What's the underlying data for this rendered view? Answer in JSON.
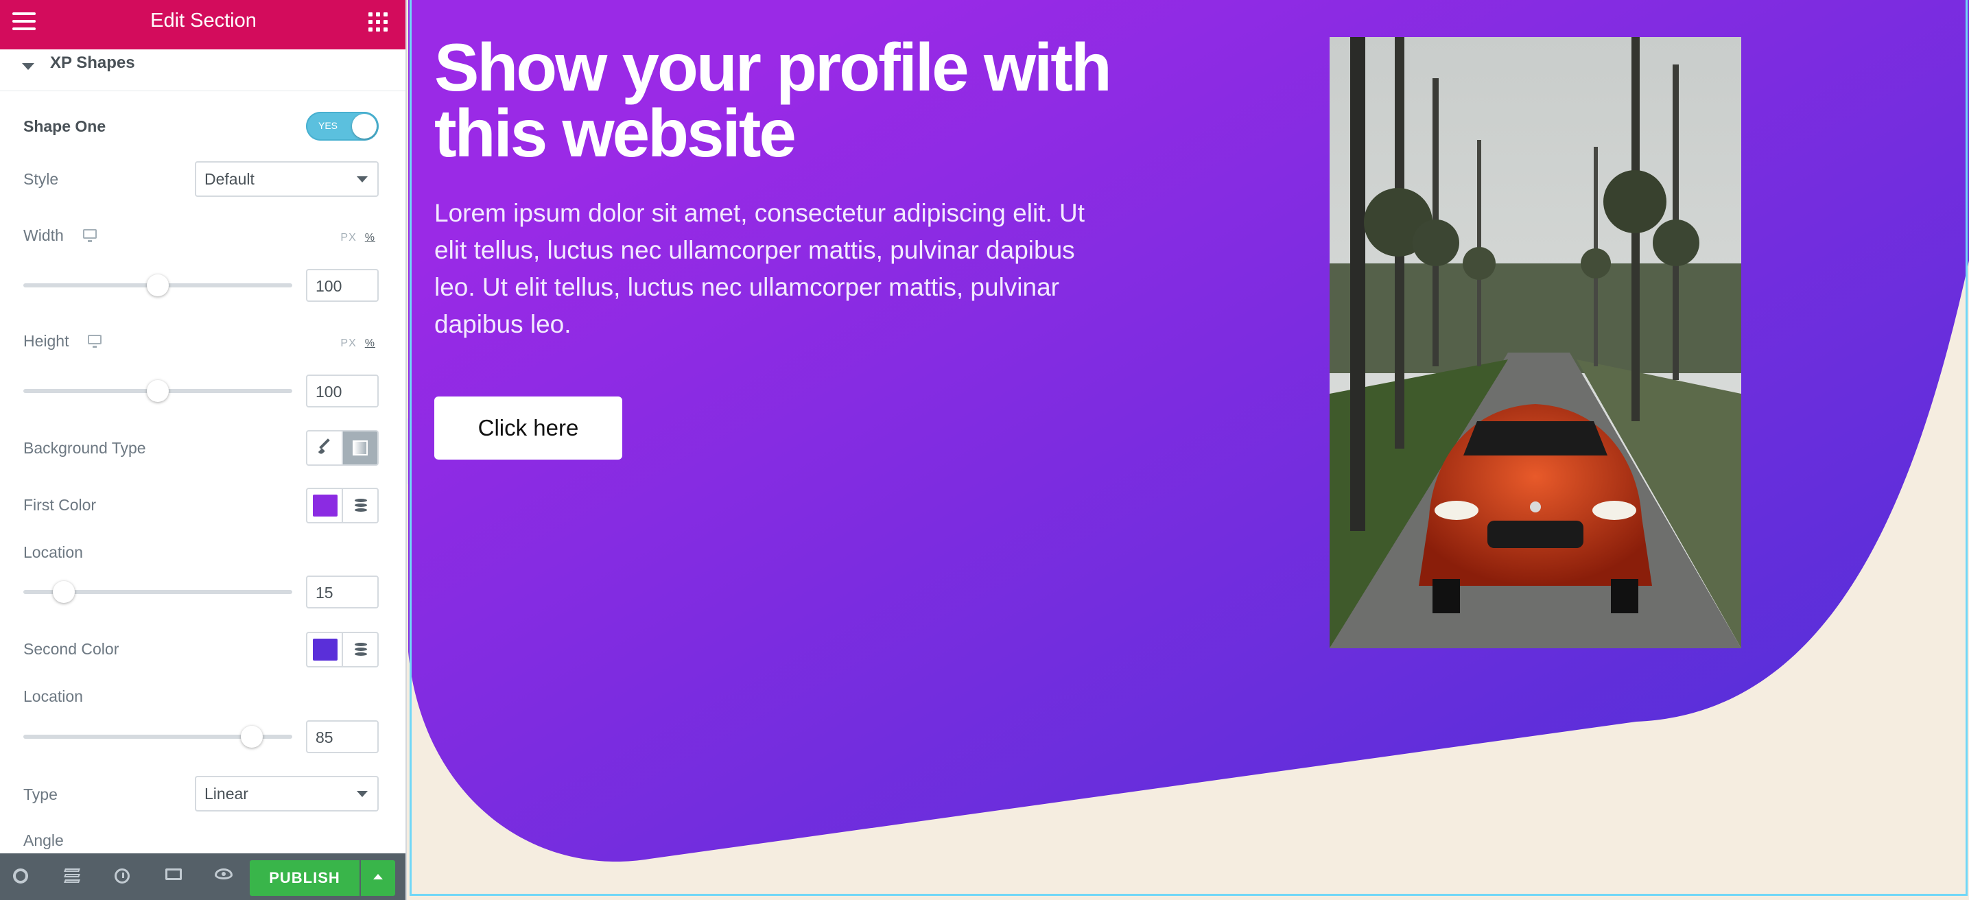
{
  "panel": {
    "title": "Edit Section",
    "section_label": "XP Shapes",
    "shape_one": {
      "label": "Shape One",
      "toggle_text": "YES"
    },
    "style": {
      "label": "Style",
      "value": "Default"
    },
    "width": {
      "label": "Width",
      "unit_px": "PX",
      "unit_pct": "%",
      "value": "100",
      "level": 0.5
    },
    "height": {
      "label": "Height",
      "unit_px": "PX",
      "unit_pct": "%",
      "value": "100",
      "level": 0.5
    },
    "background_type": {
      "label": "Background Type"
    },
    "first_color": {
      "label": "First Color",
      "color": "#8b2be2"
    },
    "location_1": {
      "label": "Location",
      "value": "15",
      "level": 0.15
    },
    "second_color": {
      "label": "Second Color",
      "color": "#5a2fd9"
    },
    "location_2": {
      "label": "Location",
      "value": "85",
      "level": 0.85
    },
    "type": {
      "label": "Type",
      "value": "Linear"
    },
    "angle": {
      "label": "Angle"
    },
    "footer": {
      "publish_label": "PUBLISH"
    }
  },
  "canvas": {
    "title": "Show your profile with this website",
    "text": "Lorem ipsum dolor sit amet, consectetur adipiscing elit. Ut elit tellus, luctus nec ullamcorper mattis, pulvinar dapibus leo. Ut elit tellus, luctus nec ullamcorper mattis, pulvinar dapibus leo.",
    "button_label": "Click here",
    "image_desc_icon": "photo-red-car-palm-street",
    "colors": {
      "gradient_start": "#9a2ae6",
      "gradient_end": "#5a2fd9",
      "background": "#f5ede0",
      "accent": "#d30c5c"
    }
  }
}
